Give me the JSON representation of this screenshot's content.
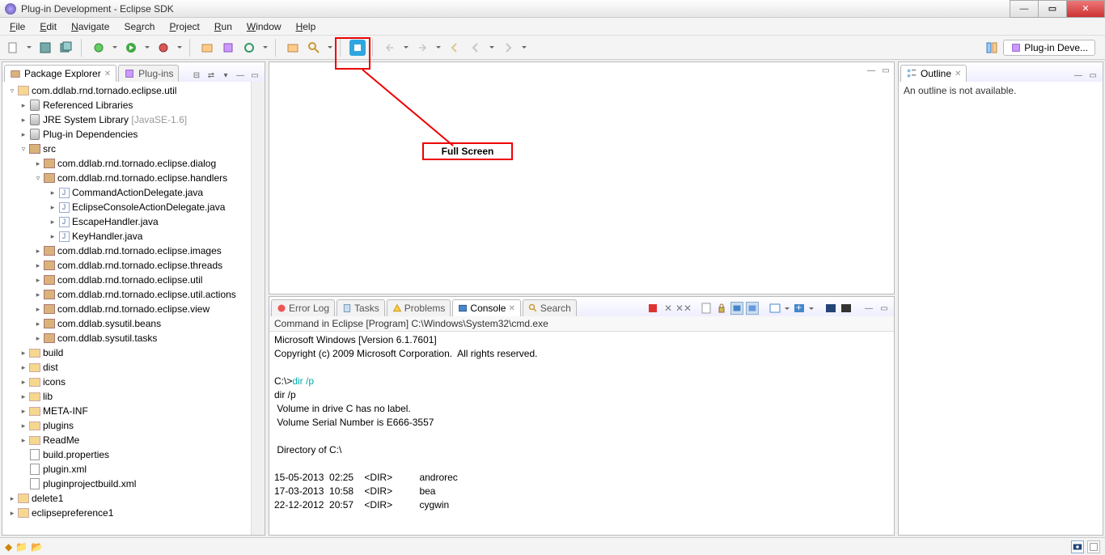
{
  "window": {
    "title": "Plug-in Development - Eclipse SDK"
  },
  "menus": [
    "File",
    "Edit",
    "Navigate",
    "Search",
    "Project",
    "Run",
    "Window",
    "Help"
  ],
  "perspective": {
    "label": "Plug-in Deve..."
  },
  "packageExplorer": {
    "tabLabel": "Package Explorer",
    "secondTab": "Plug-ins",
    "project": "com.ddlab.rnd.tornado.eclipse.util",
    "referencedLibs": "Referenced Libraries",
    "jre": "JRE System Library",
    "jreVer": "[JavaSE-1.6]",
    "pluginDeps": "Plug-in Dependencies",
    "src": "src",
    "pkgDialog": "com.ddlab.rnd.tornado.eclipse.dialog",
    "pkgHandlers": "com.ddlab.rnd.tornado.eclipse.handlers",
    "javaFiles": [
      "CommandActionDelegate.java",
      "EclipseConsoleActionDelegate.java",
      "EscapeHandler.java",
      "KeyHandler.java"
    ],
    "pkgImages": "com.ddlab.rnd.tornado.eclipse.images",
    "pkgThreads": "com.ddlab.rnd.tornado.eclipse.threads",
    "pkgUtil": "com.ddlab.rnd.tornado.eclipse.util",
    "pkgUtilActions": "com.ddlab.rnd.tornado.eclipse.util.actions",
    "pkgView": "com.ddlab.rnd.tornado.eclipse.view",
    "pkgBeans": "com.ddlab.sysutil.beans",
    "pkgTasks": "com.ddlab.sysutil.tasks",
    "folders": [
      "build",
      "dist",
      "icons",
      "lib",
      "META-INF",
      "plugins",
      "ReadMe"
    ],
    "files": [
      "build.properties",
      "plugin.xml",
      "pluginprojectbuild.xml"
    ],
    "proj2": "delete1",
    "proj3": "eclipsepreference1"
  },
  "annotation": {
    "label": "Full Screen"
  },
  "outline": {
    "tabLabel": "Outline",
    "message": "An outline is not available."
  },
  "bottomTabs": {
    "errorLog": "Error Log",
    "tasks": "Tasks",
    "problems": "Problems",
    "console": "Console",
    "search": "Search"
  },
  "console": {
    "desc": "Command in Eclipse [Program] C:\\Windows\\System32\\cmd.exe",
    "l1": "Microsoft Windows [Version 6.1.7601]",
    "l2": "Copyright (c) 2009 Microsoft Corporation.  All rights reserved.",
    "prompt": "C:\\>",
    "cmd": "dir /p",
    "echo": "dir /p",
    "v1": " Volume in drive C has no label.",
    "v2": " Volume Serial Number is E666-3557",
    "dirof": " Directory of C:\\",
    "r1": "15-05-2013  02:25    <DIR>          androrec",
    "r2": "17-03-2013  10:58    <DIR>          bea",
    "r3": "22-12-2012  20:57    <DIR>          cygwin"
  }
}
